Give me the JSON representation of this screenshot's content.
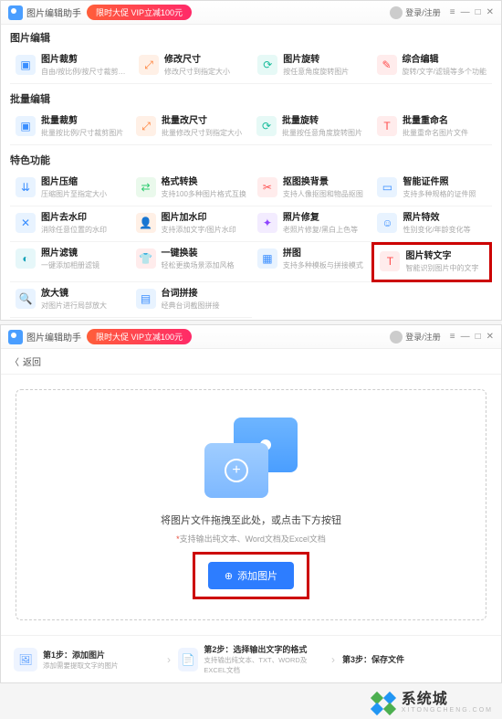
{
  "app": {
    "title": "图片编辑助手",
    "promo": "限时大促 VIP立减100元",
    "login": "登录/注册"
  },
  "sections": {
    "edit": {
      "title": "图片编辑",
      "items": [
        {
          "title": "图片裁剪",
          "desc": "自由/按比例/按尺寸裁剪图片"
        },
        {
          "title": "修改尺寸",
          "desc": "修改尺寸到指定大小"
        },
        {
          "title": "图片旋转",
          "desc": "按任意角度旋转图片"
        },
        {
          "title": "综合编辑",
          "desc": "旋转/文字/滤镜等多个功能"
        }
      ]
    },
    "batch": {
      "title": "批量编辑",
      "items": [
        {
          "title": "批量裁剪",
          "desc": "批量按比例/尺寸裁剪图片"
        },
        {
          "title": "批量改尺寸",
          "desc": "批量修改尺寸到指定大小"
        },
        {
          "title": "批量旋转",
          "desc": "批量按任意角度旋转图片"
        },
        {
          "title": "批量重命名",
          "desc": "批量重命名图片文件"
        }
      ]
    },
    "special": {
      "title": "特色功能",
      "items": [
        {
          "title": "图片压缩",
          "desc": "压缩图片至指定大小"
        },
        {
          "title": "格式转换",
          "desc": "支持100多种图片格式互换"
        },
        {
          "title": "抠图换背景",
          "desc": "支持人像抠图和物品抠图"
        },
        {
          "title": "智能证件照",
          "desc": "支持多种规格的证件照"
        },
        {
          "title": "图片去水印",
          "desc": "消除任意位置的水印"
        },
        {
          "title": "图片加水印",
          "desc": "支持添加文字/图片水印"
        },
        {
          "title": "照片修复",
          "desc": "老照片修复/黑白上色等"
        },
        {
          "title": "照片特效",
          "desc": "性别变化/年龄变化等"
        },
        {
          "title": "照片滤镜",
          "desc": "一键添加相册滤镜"
        },
        {
          "title": "一键换装",
          "desc": "轻松更换场景添加风格"
        },
        {
          "title": "拼图",
          "desc": "支持多种模板与拼接模式"
        },
        {
          "title": "图片转文字",
          "desc": "智能识别图片中的文字"
        },
        {
          "title": "放大镜",
          "desc": "对图片进行局部放大"
        },
        {
          "title": "台词拼接",
          "desc": "经典台词截图拼接"
        }
      ]
    }
  },
  "page2": {
    "back": "返回",
    "drop_title": "将图片文件拖拽至此处，或点击下方按钮",
    "drop_formats": "支持输出纯文本、Word文档及Excel文档",
    "add_btn": "添加图片",
    "steps": [
      {
        "title": "第1步：添加图片",
        "desc": "添加需要提取文字的图片"
      },
      {
        "title": "第2步：选择输出文字的格式",
        "desc": "支持输出纯文本、TXT、WORD及EXCEL文档"
      },
      {
        "title": "第3步：保存文件",
        "desc": ""
      }
    ]
  },
  "watermark": {
    "title": "系统城",
    "sub": "XITONGCHENG.COM"
  }
}
